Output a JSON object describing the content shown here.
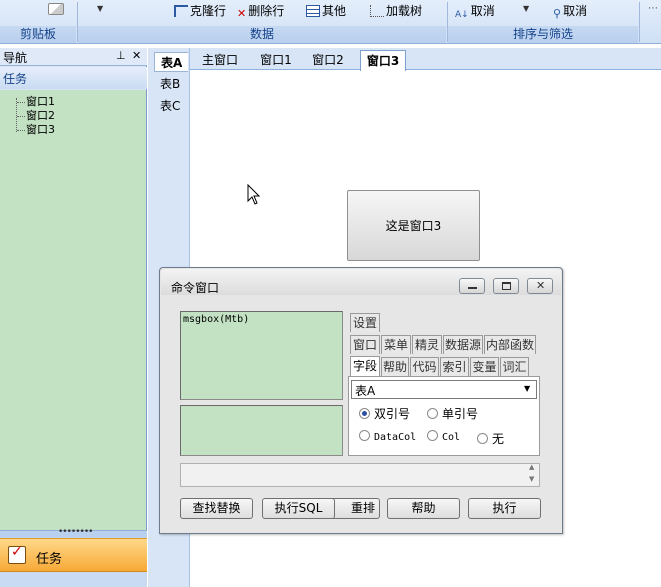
{
  "ribbon": {
    "groups": {
      "clipboard": "剪贴板",
      "data": "数据",
      "sort_filter": "排序与筛选"
    },
    "buttons": {
      "clone_row": "克隆行",
      "delete_row": "删除行",
      "other": "其他",
      "load_tree": "加载树",
      "cancel1": "取消",
      "cancel2": "取消"
    }
  },
  "nav": {
    "title": "导航",
    "pin_glyph": "⊥",
    "close_glyph": "✕",
    "section": "任务",
    "tree": [
      "窗口1",
      "窗口2",
      "窗口3"
    ],
    "task_button": "任务"
  },
  "tables": [
    "表A",
    "表B",
    "表C"
  ],
  "window_tabs": [
    "主窗口",
    "窗口1",
    "窗口2",
    "窗口3"
  ],
  "child_window": {
    "text": "这是窗口3"
  },
  "cmd": {
    "title": "命令窗口",
    "code": "msgbox(Mtb)",
    "tabs_row1": [
      "设置"
    ],
    "tabs_row2": [
      "窗口",
      "菜单",
      "精灵",
      "数据源",
      "内部函数"
    ],
    "tabs_row3": [
      "字段",
      "帮助",
      "代码",
      "索引",
      "变量",
      "词汇"
    ],
    "field_select": "表A",
    "radios": {
      "double_quote": "双引号",
      "single_quote": "单引号",
      "datacol": "DataCol",
      "col": "Col",
      "none": "无"
    },
    "buttons": {
      "find_replace": "查找替换",
      "exec_sql": "执行SQL",
      "hidden_fragment": "重排",
      "help": "帮助",
      "execute": "执行"
    }
  },
  "colors": {
    "green_panel": "#c3e1c3",
    "task_orange": "#f7a937",
    "ribbon_blue": "#cfe0f5"
  }
}
